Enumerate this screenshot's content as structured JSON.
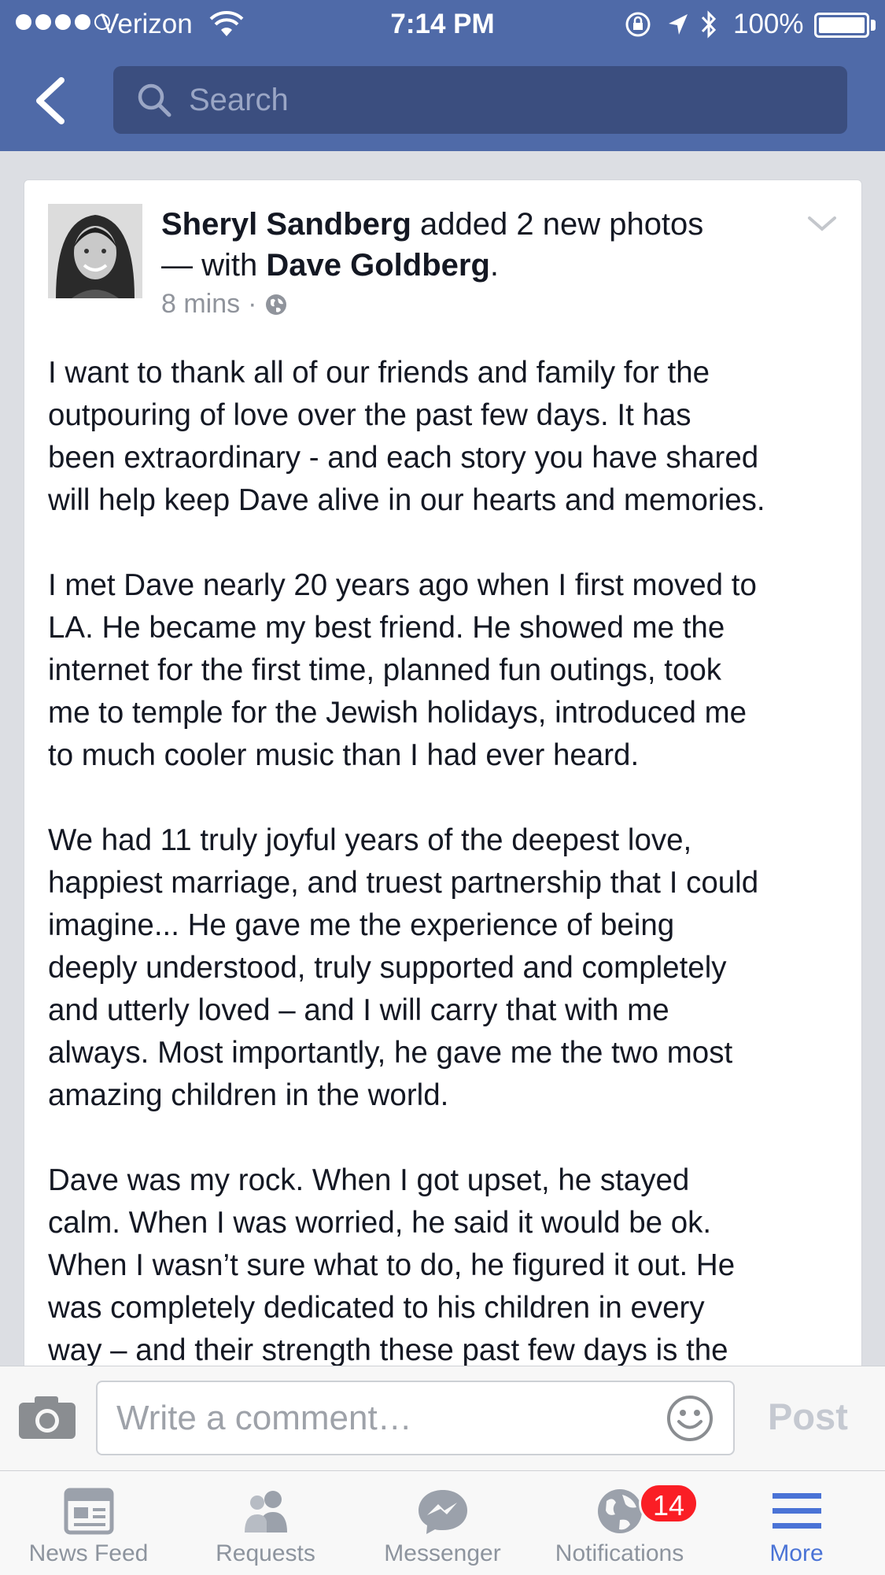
{
  "status_bar": {
    "carrier": "Verizon",
    "time": "7:14 PM",
    "battery": "100%"
  },
  "header": {
    "search_placeholder": "Search"
  },
  "post": {
    "author": "Sheryl Sandberg",
    "action": "added 2 new photos",
    "with_prefix": "— with",
    "tagged": "Dave Goldberg",
    "tagged_suffix": ".",
    "time": "8 mins",
    "meta_separator": "·",
    "paragraphs": [
      {
        "lines": [
          "I want to thank all of our friends and family for the",
          "outpouring of love over the past few days. It has",
          "been extraordinary - and each story you have shared",
          "will help keep Dave alive in our hearts and memories."
        ]
      },
      {
        "lines": [
          "I met Dave nearly 20 years ago when I first moved to",
          "LA. He became my best friend. He showed me the",
          "internet for the first time, planned fun outings, took",
          "me to temple for the Jewish holidays, introduced me",
          "to much cooler music than I had ever heard."
        ]
      },
      {
        "lines": [
          "We had 11 truly joyful years of the deepest love,",
          "happiest marriage, and truest partnership that I could",
          "imagine... He gave me the experience of being",
          "deeply understood, truly supported and completely",
          "and utterly loved – and I will carry that with me",
          "always.  Most importantly, he gave me the two most",
          "amazing children in the world."
        ]
      },
      {
        "lines": [
          "Dave was my rock. When I got upset, he stayed",
          "calm. When I was worried, he said it would be ok.",
          "When I wasn’t sure what to do, he figured it out. He",
          "was completely dedicated to his children in every",
          "way – and their strength these past few days is the"
        ]
      }
    ]
  },
  "comment_bar": {
    "placeholder": "Write a comment…",
    "post_label": "Post"
  },
  "tabs": [
    {
      "label": "News Feed",
      "icon": "news-feed-icon"
    },
    {
      "label": "Requests",
      "icon": "friend-requests-icon"
    },
    {
      "label": "Messenger",
      "icon": "messenger-icon"
    },
    {
      "label": "Notifications",
      "icon": "globe-notifications-icon",
      "badge": "14"
    },
    {
      "label": "More",
      "icon": "hamburger-menu-icon",
      "active": true
    }
  ],
  "colors": {
    "header_blue": "#4f6aa8",
    "search_bg": "#3b4e7f",
    "active_tab": "#4a73d6",
    "badge_red": "#fa1e25"
  }
}
